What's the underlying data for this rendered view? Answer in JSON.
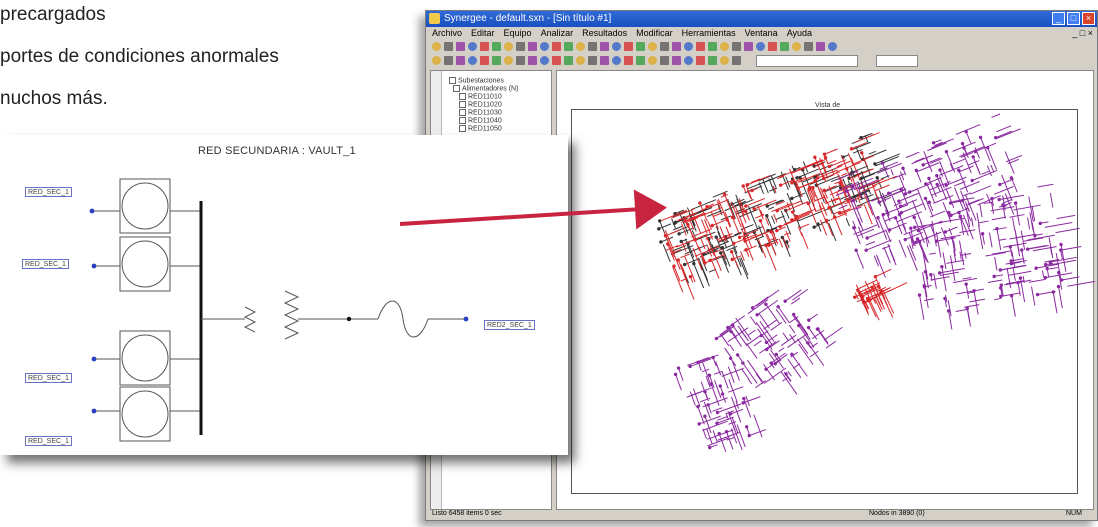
{
  "left_text": {
    "line1": "precargados",
    "line2": "portes de condiciones anormales",
    "line3": "nuchos más."
  },
  "app": {
    "title": "Synergee - default.sxn - [Sin título #1]",
    "menu": [
      "Archivo",
      "Editar",
      "Equipo",
      "Analizar",
      "Resultados",
      "Modificar",
      "Herramientas",
      "Ventana",
      "Ayuda"
    ],
    "mdi_close": "_ □ ×",
    "tree": {
      "root": "Subestaciones",
      "group": "Alimentadores (N)",
      "items": [
        "RED11010",
        "RED11020",
        "RED11030",
        "RED11040",
        "RED11050"
      ]
    },
    "plot_label": "Vista de",
    "status_left": "Listo   6458 items   0 sec",
    "status_mid": "Nodos in  3890 (0)",
    "status_right": "NUM",
    "colors": {
      "titlebar": "#1f58c9",
      "chrome": "#d4d0c8",
      "net_red": "#d8282b",
      "net_purple": "#8b2aa0",
      "net_black": "#333333"
    }
  },
  "detail": {
    "title": "RED SECUNDARIA : VAULT_1",
    "feeders": [
      "RED_SEC_1",
      "RED_SEC_1",
      "RED_SEC_1",
      "RED_SEC_1",
      "RED_SEC_1"
    ],
    "output_label": "RED2_SEC_1"
  },
  "arrow": {
    "color": "#c8233f"
  }
}
